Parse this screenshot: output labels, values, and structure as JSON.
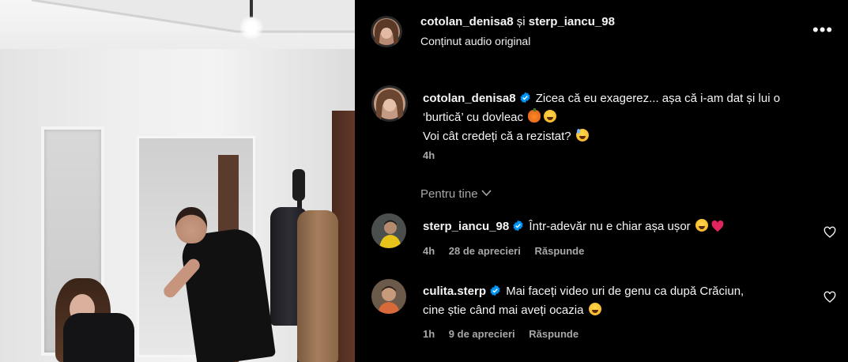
{
  "header": {
    "user1": "cotolan_denisa8",
    "separator": "și",
    "user2": "sterp_iancu_98",
    "audio": "Conținut audio original"
  },
  "caption": {
    "username": "cotolan_denisa8",
    "line1": "Zicea că eu exagerez... așa că i-am dat și lui o ‘burtică’ cu dovleac",
    "line2": "Voi cât credeți că a rezistat?",
    "time": "4h"
  },
  "filter": {
    "label": "Pentru tine"
  },
  "comments": [
    {
      "username": "sterp_iancu_98",
      "text": "Într-adevăr nu e chiar așa ușor",
      "time": "4h",
      "likes": "28 de aprecieri",
      "reply": "Răspunde"
    },
    {
      "username": "culita.sterp",
      "text_line1": "Mai faceți video uri de genu ca după Crăciun,",
      "text_line2": "cine știe când mai aveți ocazia",
      "time": "1h",
      "likes": "9 de aprecieri",
      "reply": "Răspunde"
    }
  ],
  "icons": {
    "more": "more-options-icon",
    "verified": "verified-badge-icon",
    "heart": "heart-outline-icon",
    "chevron": "chevron-down-icon"
  },
  "colors": {
    "background": "#000000",
    "text": "#f5f5f5",
    "secondary": "#a8a8a8",
    "verified": "#0095f6",
    "heart_emoji": "#e0245e"
  }
}
